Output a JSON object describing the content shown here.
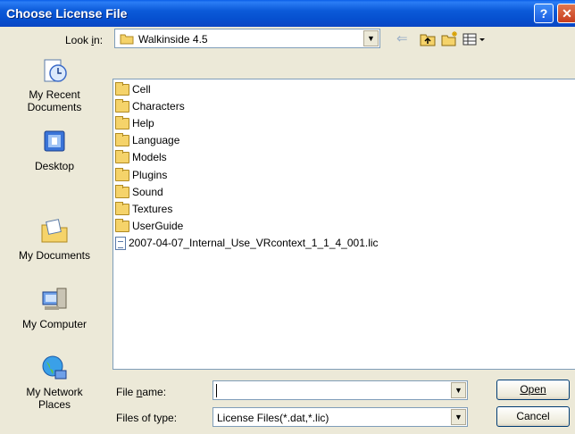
{
  "window": {
    "title": "Choose License File",
    "help_glyph": "?",
    "close_glyph": "✕"
  },
  "lookin": {
    "label": "Look in:",
    "value": "Walkinside 4.5"
  },
  "toolbar": {
    "back_glyph": "⇐",
    "up_glyph": "⮤",
    "newfolder_glyph": "✱",
    "views_glyph": "▦▾"
  },
  "places": [
    {
      "label": "My Recent\nDocuments",
      "icon": "recent-documents-icon"
    },
    {
      "label": "Desktop",
      "icon": "desktop-icon"
    },
    {
      "label": "My Documents",
      "icon": "my-documents-icon"
    },
    {
      "label": "My Computer",
      "icon": "my-computer-icon"
    },
    {
      "label": "My Network\nPlaces",
      "icon": "network-places-icon"
    }
  ],
  "files": [
    {
      "name": "Cell",
      "type": "folder"
    },
    {
      "name": "Characters",
      "type": "folder"
    },
    {
      "name": "Help",
      "type": "folder"
    },
    {
      "name": "Language",
      "type": "folder"
    },
    {
      "name": "Models",
      "type": "folder"
    },
    {
      "name": "Plugins",
      "type": "folder"
    },
    {
      "name": "Sound",
      "type": "folder"
    },
    {
      "name": "Textures",
      "type": "folder"
    },
    {
      "name": "UserGuide",
      "type": "folder"
    },
    {
      "name": "2007-04-07_Internal_Use_VRcontext_1_1_4_001.lic",
      "type": "file"
    }
  ],
  "filename": {
    "label": "File name:",
    "value": ""
  },
  "filetype": {
    "label": "Files of type:",
    "value": "License Files(*.dat,*.lic)"
  },
  "buttons": {
    "open": "Open",
    "cancel": "Cancel"
  },
  "colors": {
    "titlebar": "#0a5ad8",
    "face": "#ece9d8",
    "border": "#7f9db9"
  }
}
